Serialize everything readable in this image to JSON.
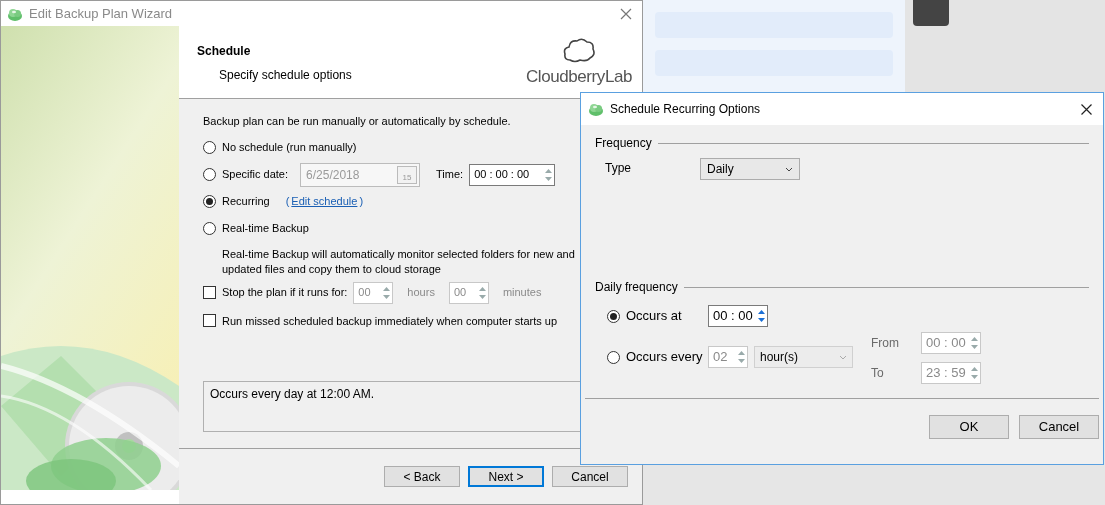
{
  "wizard": {
    "title": "Edit Backup Plan Wizard",
    "header": {
      "title": "Schedule",
      "subtitle": "Specify schedule options"
    },
    "logo_text": "CloudberryLab",
    "intro": "Backup plan can be run manually or automatically by schedule.",
    "options": [
      {
        "kind": "plain",
        "label": "No schedule (run manually)",
        "selected": false
      },
      {
        "kind": "date",
        "label": "Specific date:",
        "selected": false,
        "date": "6/25/2018",
        "calendar_day": "15",
        "time_label": "Time:",
        "time": "00 : 00 : 00"
      },
      {
        "kind": "link",
        "label": "Recurring",
        "selected": true,
        "link_open": "(",
        "link": "Edit schedule",
        "link_close": ")"
      },
      {
        "kind": "plain",
        "label": "Real-time Backup",
        "selected": false
      }
    ],
    "realtime_note": "Real-time Backup will automatically monitor selected folders for new and updated files and copy them to cloud storage",
    "stop_plan": {
      "label": "Stop the plan if it runs for:",
      "checked": false,
      "hours": "00",
      "hours_label": "hours",
      "minutes": "00",
      "minutes_label": "minutes"
    },
    "run_missed": {
      "label": "Run missed scheduled backup immediately when computer starts up",
      "checked": false
    },
    "summary": "Occurs every day at 12:00 AM.",
    "buttons": [
      {
        "label": "< Back",
        "default": false
      },
      {
        "label": "Next >",
        "default": true
      },
      {
        "label": "Cancel",
        "default": false
      }
    ]
  },
  "dialog": {
    "title": "Schedule Recurring Options",
    "frequency": {
      "heading": "Frequency",
      "type_label": "Type",
      "type_value": "Daily"
    },
    "daily": {
      "heading": "Daily frequency",
      "occurs_at": {
        "label": "Occurs at",
        "selected": true,
        "time": "00 : 00"
      },
      "occurs_every": {
        "label": "Occurs every",
        "selected": false,
        "value": "02",
        "unit": "hour(s)",
        "from_label": "From",
        "from": "00 : 00",
        "to_label": "To",
        "to": "23 : 59"
      }
    },
    "buttons": [
      {
        "label": "OK"
      },
      {
        "label": "Cancel"
      }
    ]
  }
}
